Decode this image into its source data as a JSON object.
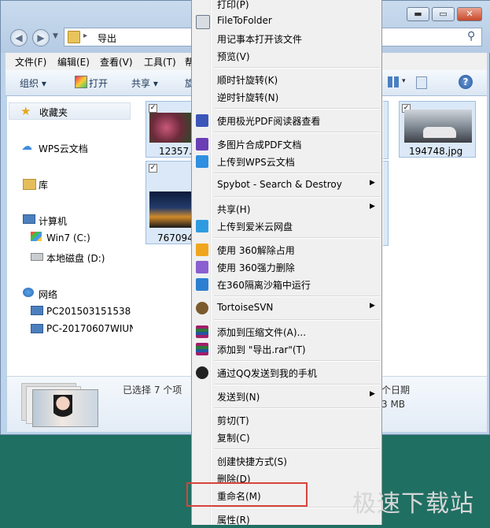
{
  "window": {
    "address": "导出",
    "controls": {
      "minimize": "▬",
      "maximize": "▭",
      "close": "✕"
    }
  },
  "menubar": [
    "文件(F)",
    "编辑(E)",
    "查看(V)",
    "工具(T)",
    "帮"
  ],
  "toolbar": {
    "organize": "组织 ▾",
    "open": "打开",
    "share": "共享 ▾",
    "rotate": "旋"
  },
  "nav": {
    "favorites": "收藏夹",
    "wps": "WPS云文档",
    "library": "库",
    "computer": "计算机",
    "drive_c": "Win7 (C:)",
    "drive_d": "本地磁盘 (D:)",
    "network": "网络",
    "pc1": "PC201503151538",
    "pc2": "PC-20170607WIUN"
  },
  "files": [
    {
      "name": "12357."
    },
    {
      "name": "767094"
    },
    {
      "name": "194748.jpg"
    }
  ],
  "details": {
    "selected": "已选择 7 个项",
    "date_frag": "个日期",
    "size_frag": "3 MB"
  },
  "context_menu": [
    {
      "label": "打印(P)",
      "icon": null,
      "sub": false
    },
    {
      "label": "FileToFolder",
      "icon": "folder-gear-icon",
      "sub": false
    },
    {
      "label": "用记事本打开该文件",
      "icon": null,
      "sub": false
    },
    {
      "label": "预览(V)",
      "icon": null,
      "sub": false
    },
    {
      "sep": true
    },
    {
      "label": "顺时针旋转(K)",
      "icon": null,
      "sub": false
    },
    {
      "label": "逆时针旋转(N)",
      "icon": null,
      "sub": false
    },
    {
      "sep": true
    },
    {
      "label": "使用极光PDF阅读器查看",
      "icon": "pdf-icon",
      "sub": false
    },
    {
      "sep": true
    },
    {
      "label": "多图片合成PDF文档",
      "icon": "p-icon",
      "sub": false
    },
    {
      "label": "上传到WPS云文档",
      "icon": "cube-icon",
      "sub": false
    },
    {
      "sep": true
    },
    {
      "label": "Spybot - Search & Destroy",
      "icon": null,
      "sub": true
    },
    {
      "sep": true
    },
    {
      "label": "共享(H)",
      "icon": null,
      "sub": true
    },
    {
      "label": "上传到爱米云网盘",
      "icon": "cloud-icon",
      "sub": false
    },
    {
      "sep": true
    },
    {
      "label": "使用 360解除占用",
      "icon": "unlock-icon",
      "sub": false
    },
    {
      "label": "使用 360强力删除",
      "icon": "shred-icon",
      "sub": false
    },
    {
      "label": "在360隔离沙箱中运行",
      "icon": "sandbox-icon",
      "sub": false
    },
    {
      "sep": true
    },
    {
      "label": "TortoiseSVN",
      "icon": "tortoise-icon",
      "sub": true
    },
    {
      "sep": true
    },
    {
      "label": "添加到压缩文件(A)...",
      "icon": "winrar-icon",
      "sub": false
    },
    {
      "label": "添加到 \"导出.rar\"(T)",
      "icon": "winrar-icon",
      "sub": false
    },
    {
      "sep": true
    },
    {
      "label": "通过QQ发送到我的手机",
      "icon": "qq-icon",
      "sub": false
    },
    {
      "sep": true
    },
    {
      "label": "发送到(N)",
      "icon": null,
      "sub": true
    },
    {
      "sep": true
    },
    {
      "label": "剪切(T)",
      "icon": null,
      "sub": false
    },
    {
      "label": "复制(C)",
      "icon": null,
      "sub": false
    },
    {
      "sep": true
    },
    {
      "label": "创建快捷方式(S)",
      "icon": null,
      "sub": false
    },
    {
      "label": "删除(D)",
      "icon": null,
      "sub": false
    },
    {
      "label": "重命名(M)",
      "icon": null,
      "sub": false
    },
    {
      "sep": true
    },
    {
      "label": "属性(R)",
      "icon": null,
      "sub": false
    }
  ],
  "watermark": "极速下载站",
  "colors": {
    "desktop": "#1f6f62",
    "highlight": "#d8433c"
  }
}
